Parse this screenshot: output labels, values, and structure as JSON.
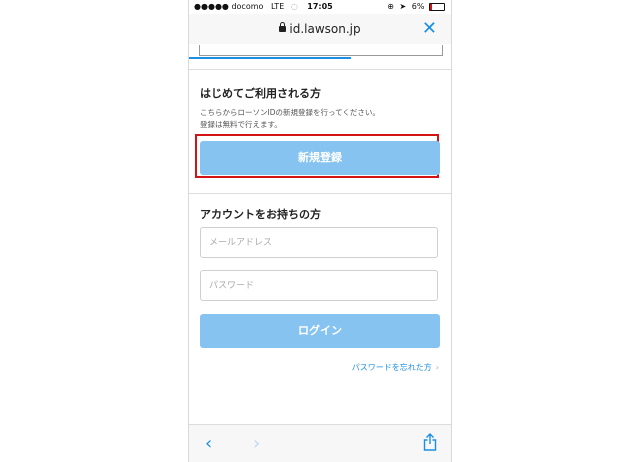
{
  "status_bar": {
    "carrier": "●●●●● docomo",
    "network": "LTE",
    "time": "17:05",
    "battery": "6%"
  },
  "browser": {
    "url": "id.lawson.jp",
    "close_icon": "close-icon",
    "progress": 0.62
  },
  "new_user": {
    "heading": "はじめてご利用される方",
    "desc_line1": "こちらからローソンIDの新規登録を行ってください。",
    "desc_line2": "登録は無料で行えます。",
    "register_button": "新規登録"
  },
  "account": {
    "heading": "アカウントをお持ちの方",
    "email_placeholder": "メールアドレス",
    "email_value": "",
    "password_placeholder": "パスワード",
    "password_value": "",
    "login_button": "ログイン",
    "forgot_link": "パスワードを忘れた方"
  },
  "toolbar": {
    "back_icon": "chevron-left-icon",
    "forward_icon": "chevron-right-icon",
    "share_icon": "share-icon"
  },
  "colors": {
    "accent": "#1a8fe3",
    "button": "#86c3f0",
    "highlight": "#d21414"
  }
}
